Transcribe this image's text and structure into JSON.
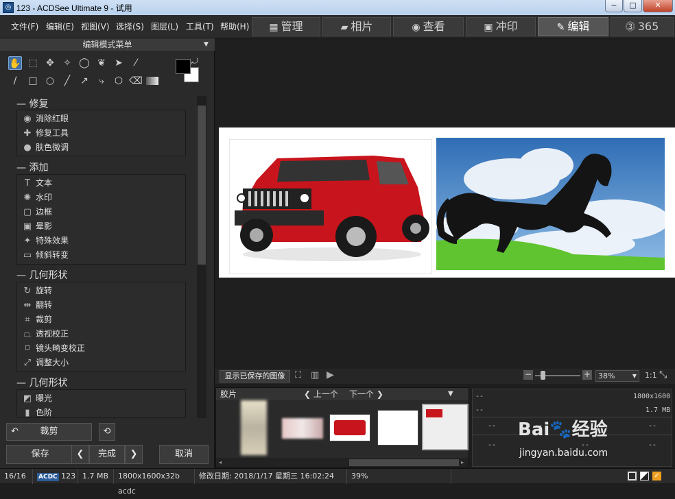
{
  "window": {
    "title": "123 - ACDSee Ultimate 9 - 试用",
    "app_icon": "acdsee-icon",
    "min": "−",
    "max": "□",
    "close": "✕"
  },
  "menu": [
    "文件(F)",
    "编辑(E)",
    "视图(V)",
    "选择(S)",
    "图层(L)",
    "工具(T)",
    "帮助(H)"
  ],
  "modes": [
    {
      "label": "管理",
      "icon": "▦"
    },
    {
      "label": "相片",
      "icon": "▰"
    },
    {
      "label": "查看",
      "icon": "◉"
    },
    {
      "label": "冲印",
      "icon": "▣"
    },
    {
      "label": "编辑",
      "icon": "✎"
    },
    {
      "label": "365",
      "icon": "⓷"
    }
  ],
  "panel": {
    "header": "编辑模式菜单",
    "header_arrow": "▼"
  },
  "sections": [
    {
      "title": "修复",
      "collapse": "—",
      "items": [
        {
          "label": "消除红眼",
          "icon": "◉"
        },
        {
          "label": "修复工具",
          "icon": "✚"
        },
        {
          "label": "肤色微调",
          "icon": "●"
        }
      ]
    },
    {
      "title": "添加",
      "collapse": "—",
      "items": [
        {
          "label": "文本",
          "icon": "T"
        },
        {
          "label": "水印",
          "icon": "✺"
        },
        {
          "label": "边框",
          "icon": "▢"
        },
        {
          "label": "晕影",
          "icon": "▣"
        },
        {
          "label": "特殊效果",
          "icon": "✦"
        },
        {
          "label": "倾斜转变",
          "icon": "▭"
        }
      ]
    },
    {
      "title": "几何形状",
      "collapse": "—",
      "items": [
        {
          "label": "旋转",
          "icon": "↻"
        },
        {
          "label": "翻转",
          "icon": "⇹"
        },
        {
          "label": "裁剪",
          "icon": "⌗"
        },
        {
          "label": "透视校正",
          "icon": "⏢"
        },
        {
          "label": "镜头畸变校正",
          "icon": "⌑"
        },
        {
          "label": "调整大小",
          "icon": "⤢"
        }
      ]
    },
    {
      "title": "几何形状",
      "collapse": "—",
      "items": [
        {
          "label": "曝光",
          "icon": "◩"
        },
        {
          "label": "色阶",
          "icon": "▮"
        }
      ]
    }
  ],
  "buttons": {
    "crop": "裁剪",
    "save": "保存",
    "done": "完成",
    "cancel": "取消",
    "prev": "❮",
    "next": "❯",
    "undo_icon": "↶",
    "reset_icon": "⟲"
  },
  "viewer_bar": {
    "show_saved": "显示已保存的图像",
    "zoom": "38%",
    "ratio": "1:1",
    "minus": "−",
    "plus": "+"
  },
  "filmstrip": {
    "label": "胶片",
    "prev": "上一个",
    "next": "下一个"
  },
  "info": {
    "dims": "1800x1600",
    "size": "1.7 MB",
    "dash": "--"
  },
  "status": {
    "index": "16/16",
    "format": "ACDC",
    "name": "123",
    "filesize": "1.7 MB",
    "details": "1800x1600x32b acdc",
    "modified": "修改日期: 2018/1/17 星期三 16:02:24",
    "zoom": "39%"
  },
  "watermark": {
    "brand": "Bai",
    "brand2": "经验",
    "site": "jingyan.baidu.com"
  },
  "colors": {
    "accent": "#3f6fa5",
    "car": "#c8141c",
    "sky": "#3f7fc4",
    "grass": "#5fc430",
    "horse": "#141414"
  }
}
